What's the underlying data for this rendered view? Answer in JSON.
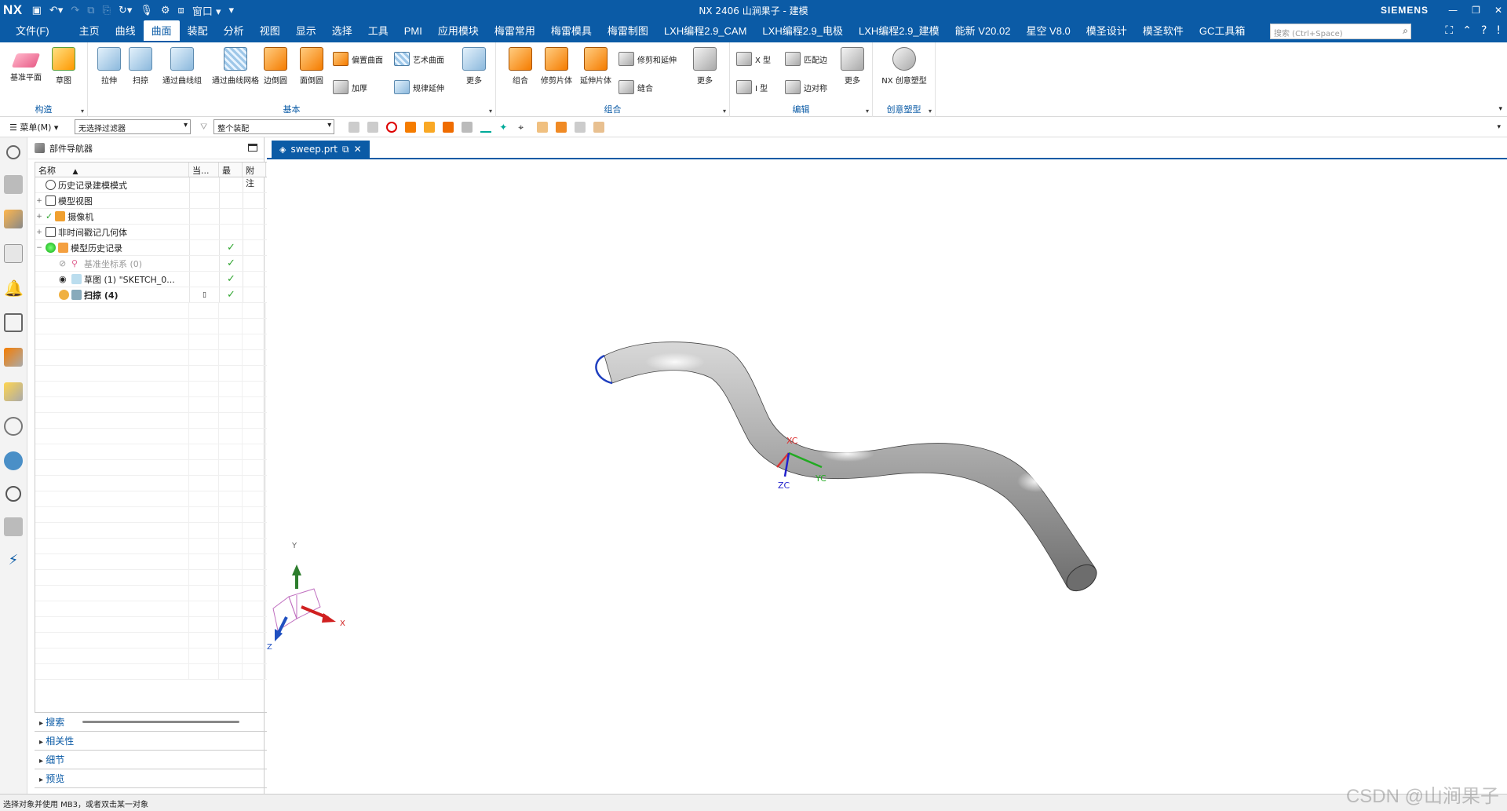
{
  "app": {
    "logo": "NX",
    "window_title": "NX 2406 山涧果子 - 建模",
    "brand": "SIEMENS"
  },
  "menu": {
    "tabs": [
      "文件(F)",
      "主页",
      "曲线",
      "曲面",
      "装配",
      "分析",
      "视图",
      "显示",
      "选择",
      "工具",
      "PMI",
      "应用模块",
      "梅雷常用",
      "梅雷模具",
      "梅雷制图",
      "LXH编程2.9_CAM",
      "LXH编程2.9_电极",
      "LXH编程2.9_建模",
      "能新 V20.02",
      "星空 V8.0",
      "模圣设计",
      "模圣软件",
      "GC工具箱"
    ],
    "active_index": 3,
    "window_menu": "窗口",
    "search_placeholder": "搜索 (Ctrl+Space)"
  },
  "ribbon": {
    "groups": [
      {
        "label": "构造",
        "buttons": [
          "基准平面",
          "草图"
        ]
      },
      {
        "label": "基本",
        "buttons": [
          "拉伸",
          "扫掠",
          "通过曲线组",
          "通过曲线网格",
          "边倒圆",
          "面倒圆"
        ],
        "small": [
          "偏置曲面",
          "加厚",
          "艺术曲面",
          "规律延伸"
        ],
        "more": "更多"
      },
      {
        "label": "组合",
        "buttons": [
          "组合",
          "修剪片体",
          "延伸片体"
        ],
        "small": [
          "修剪和延伸",
          "缝合"
        ],
        "more": "更多"
      },
      {
        "label": "编辑",
        "small": [
          "X 型",
          "I 型",
          "匹配边",
          "边对称"
        ],
        "more": "更多"
      },
      {
        "label": "创意塑型",
        "buttons": [
          "NX 创意塑型"
        ]
      }
    ]
  },
  "selection_bar": {
    "menu_label": "菜单(M)",
    "filter": "无选择过滤器",
    "scope": "整个装配"
  },
  "navigator": {
    "title": "部件导航器",
    "columns": [
      "名称",
      "当...",
      "最",
      "附注"
    ],
    "rows": [
      {
        "name": "历史记录建模模式",
        "check": false
      },
      {
        "name": "模型视图",
        "check": false
      },
      {
        "name": "摄像机",
        "check": false
      },
      {
        "name": "非时间戳记几何体",
        "check": false
      },
      {
        "name": "模型历史记录",
        "check": true
      },
      {
        "name": "基准坐标系 (0)",
        "check": true
      },
      {
        "name": "草图 (1) \"SKETCH_0...",
        "check": true
      },
      {
        "name": "扫掠 (4)",
        "check": true
      }
    ],
    "sections": [
      "搜索",
      "相关性",
      "细节",
      "预览"
    ]
  },
  "document": {
    "tab": "sweep.prt"
  },
  "viewport": {
    "wcs": {
      "x": "XC",
      "y": "YC",
      "z": "ZC"
    },
    "triad": {
      "x": "X",
      "y": "Y",
      "z": "Z"
    }
  },
  "status": {
    "message": "选择对象并使用 MB3，或者双击某一对象"
  },
  "watermark": "CSDN @山涧果子",
  "colors": {
    "title_bar": "#0b5ba6",
    "accent": "#0b5ba6",
    "check": "#2fa52f"
  }
}
